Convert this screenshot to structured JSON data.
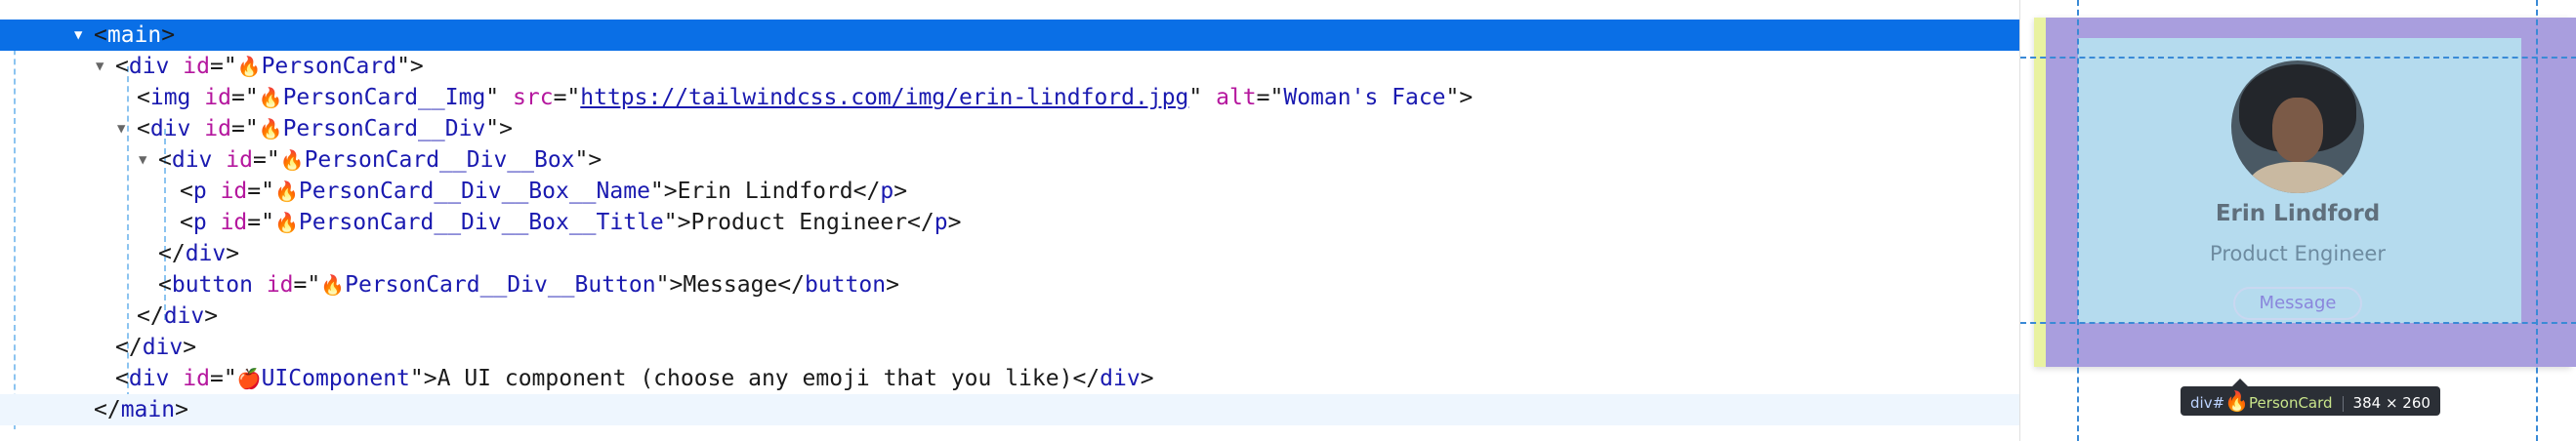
{
  "tree": {
    "rows": [
      {
        "kind": "open",
        "twisty": "expanded",
        "selected": true,
        "tag": "main"
      },
      {
        "kind": "open",
        "twisty": "expanded",
        "tag": "div",
        "attrs": [
          {
            "name": "id",
            "emoji": "🔥",
            "value": "PersonCard"
          }
        ]
      },
      {
        "kind": "void",
        "tag": "img",
        "attrs": [
          {
            "name": "id",
            "emoji": "🔥",
            "value": "PersonCard__Img"
          },
          {
            "name": "src",
            "value": "https://tailwindcss.com/img/erin-lindford.jpg",
            "link": true
          },
          {
            "name": "alt",
            "value": "Woman's Face"
          }
        ]
      },
      {
        "kind": "open",
        "twisty": "expanded",
        "tag": "div",
        "attrs": [
          {
            "name": "id",
            "emoji": "🔥",
            "value": "PersonCard__Div"
          }
        ]
      },
      {
        "kind": "open",
        "twisty": "expanded",
        "tag": "div",
        "attrs": [
          {
            "name": "id",
            "emoji": "🔥",
            "value": "PersonCard__Div__Box"
          }
        ]
      },
      {
        "kind": "inline",
        "tag": "p",
        "attrs": [
          {
            "name": "id",
            "emoji": "🔥",
            "value": "PersonCard__Div__Box__Name"
          }
        ],
        "text": "Erin Lindford"
      },
      {
        "kind": "inline",
        "tag": "p",
        "attrs": [
          {
            "name": "id",
            "emoji": "🔥",
            "value": "PersonCard__Div__Box__Title"
          }
        ],
        "text": "Product Engineer"
      },
      {
        "kind": "close",
        "tag": "div"
      },
      {
        "kind": "inline",
        "tag": "button",
        "attrs": [
          {
            "name": "id",
            "emoji": "🔥",
            "value": "PersonCard__Div__Button"
          }
        ],
        "text": "Message"
      },
      {
        "kind": "close",
        "tag": "div"
      },
      {
        "kind": "close",
        "tag": "div"
      },
      {
        "kind": "inline",
        "tag": "div",
        "attrs": [
          {
            "name": "id",
            "emoji": "🍎",
            "value": "UIComponent"
          }
        ],
        "text": "A UI component (choose any emoji that you like)"
      },
      {
        "kind": "close",
        "tag": "main",
        "hovered": true
      }
    ]
  },
  "preview": {
    "name": "Erin Lindford",
    "title": "Product Engineer",
    "button_label": "Message",
    "image_alt": "Woman's Face"
  },
  "tooltip": {
    "element": "div#",
    "emoji": "🔥",
    "id": "PersonCard",
    "size": "384 × 260"
  },
  "colors": {
    "selection": "#0a6fe6",
    "tag": "#1a1ab0",
    "attribute": "#b5179e",
    "margin": "#e9f2a1",
    "padding": "#a99ede",
    "content": "#b5dbee"
  }
}
